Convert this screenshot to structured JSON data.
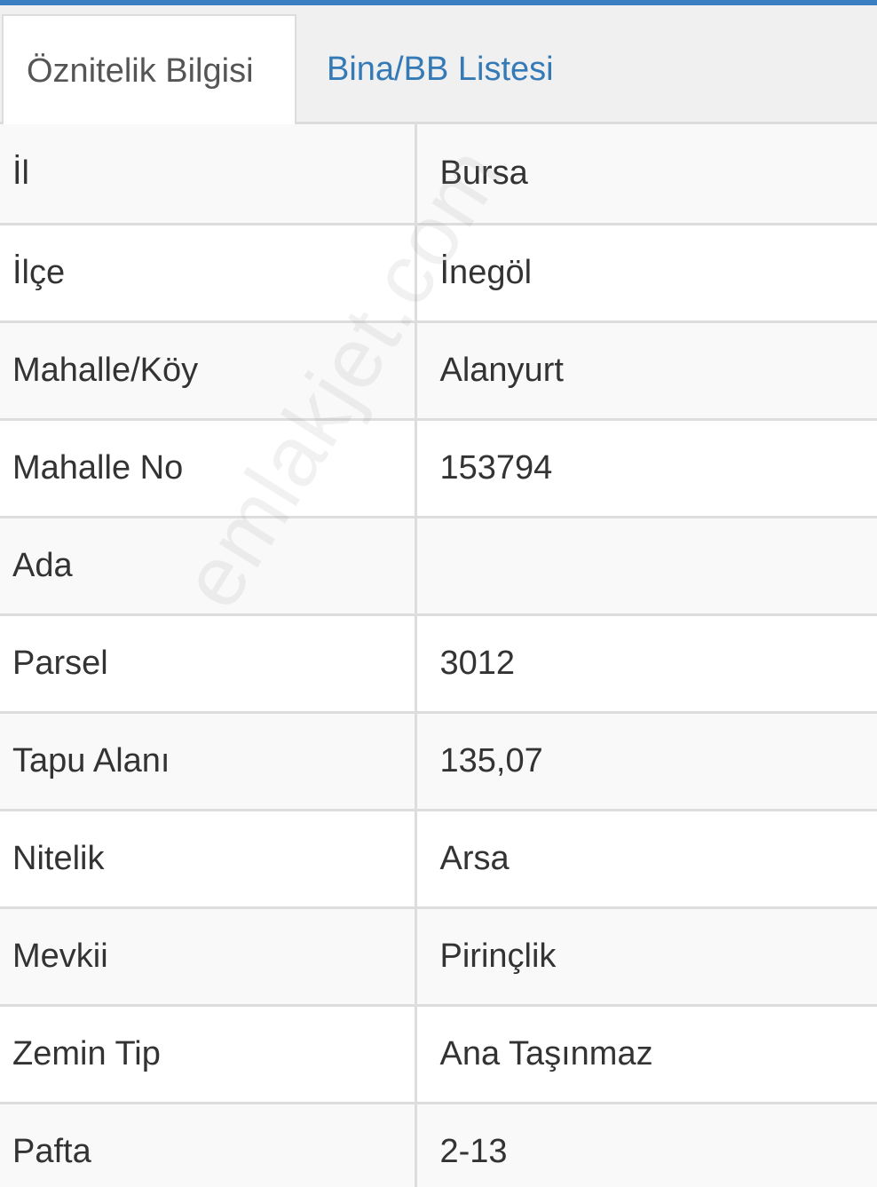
{
  "tabs": [
    {
      "label": "Öznitelik Bilgisi",
      "active": true
    },
    {
      "label": "Bina/BB Listesi",
      "active": false
    }
  ],
  "rows": [
    {
      "key": "İl",
      "value": "Bursa"
    },
    {
      "key": "İlçe",
      "value": "İnegöl"
    },
    {
      "key": "Mahalle/Köy",
      "value": "Alanyurt"
    },
    {
      "key": "Mahalle No",
      "value": "153794"
    },
    {
      "key": "Ada",
      "value": ""
    },
    {
      "key": "Parsel",
      "value": "3012"
    },
    {
      "key": "Tapu Alanı",
      "value": "135,07"
    },
    {
      "key": "Nitelik",
      "value": "Arsa"
    },
    {
      "key": "Mevkii",
      "value": "Pirinçlik"
    },
    {
      "key": "Zemin Tip",
      "value": "Ana Taşınmaz"
    },
    {
      "key": "Pafta",
      "value": "2-13"
    }
  ],
  "watermark": "emlakjet.com",
  "colors": {
    "accent": "#3a7fc1",
    "tab_link": "#337ab7",
    "row_stripe": "#f9f9f9",
    "border": "#dddddd"
  }
}
